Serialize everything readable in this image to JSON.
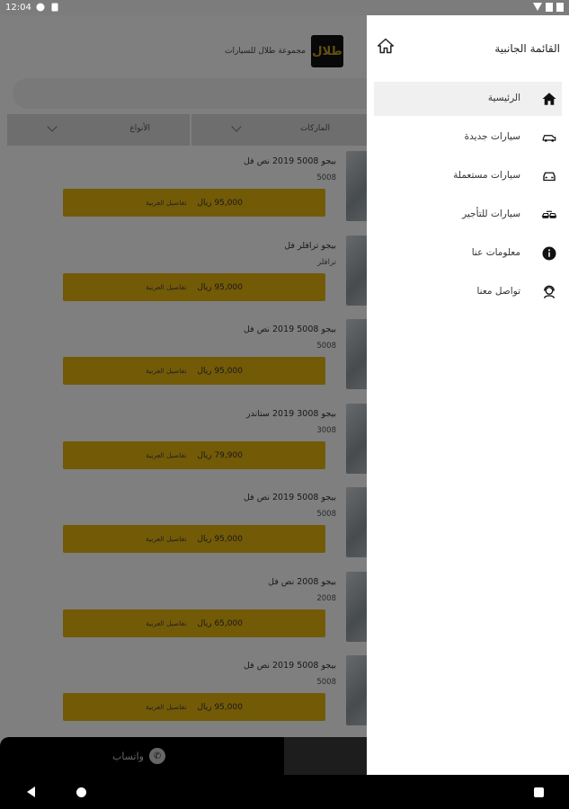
{
  "status_bar": {
    "time": "12:04"
  },
  "header": {
    "brand_name": "مجموعة طلال للسيارات",
    "logo_text": "طلال"
  },
  "filters": [
    {
      "label": "الأنواع"
    },
    {
      "label": "الماركات"
    }
  ],
  "listings": [
    {
      "title": "بيجو 5008  2019  نص فل",
      "model": "5008",
      "price": "95,000 ريال",
      "details": "تفاصيل العربية"
    },
    {
      "title": "بيجو ترافلر  فل",
      "model": "ترافلر",
      "price": "95,000 ريال",
      "details": "تفاصيل العربية"
    },
    {
      "title": "بيجو 5008  2019  نص فل",
      "model": "5008",
      "price": "95,000 ريال",
      "details": "تفاصيل العربية"
    },
    {
      "title": "بيجو 3008  2019  ستاندر",
      "model": "3008",
      "price": "79,900 ريال",
      "details": "تفاصيل العربية"
    },
    {
      "title": "بيجو 5008  2019  نص فل",
      "model": "5008",
      "price": "95,000 ريال",
      "details": "تفاصيل العربية"
    },
    {
      "title": "بيجو 2008   نص فل",
      "model": "2008",
      "price": "65,000 ريال",
      "details": "تفاصيل العربية"
    },
    {
      "title": "بيجو 5008  2019  نص فل",
      "model": "5008",
      "price": "95,000 ريال",
      "details": "تفاصيل العربية"
    }
  ],
  "bottom_bar": {
    "whatsapp_label": "واتساب"
  },
  "drawer": {
    "title": "القائمة الجانبية",
    "items": [
      {
        "label": "الرئيسية",
        "icon": "home-icon",
        "active": true
      },
      {
        "label": "سيارات جديدة",
        "icon": "new-car-icon",
        "active": false
      },
      {
        "label": "سيارات مستعملة",
        "icon": "used-car-icon",
        "active": false
      },
      {
        "label": "سيارات للتأجير",
        "icon": "rental-car-icon",
        "active": false
      },
      {
        "label": "معلومات عنا",
        "icon": "info-icon",
        "active": false
      },
      {
        "label": "تواصل معنا",
        "icon": "support-agent-icon",
        "active": false
      }
    ]
  },
  "colors": {
    "accent": "#e7b40f",
    "scrim": "#00000080",
    "drawer_active": "#f0f0f0"
  }
}
